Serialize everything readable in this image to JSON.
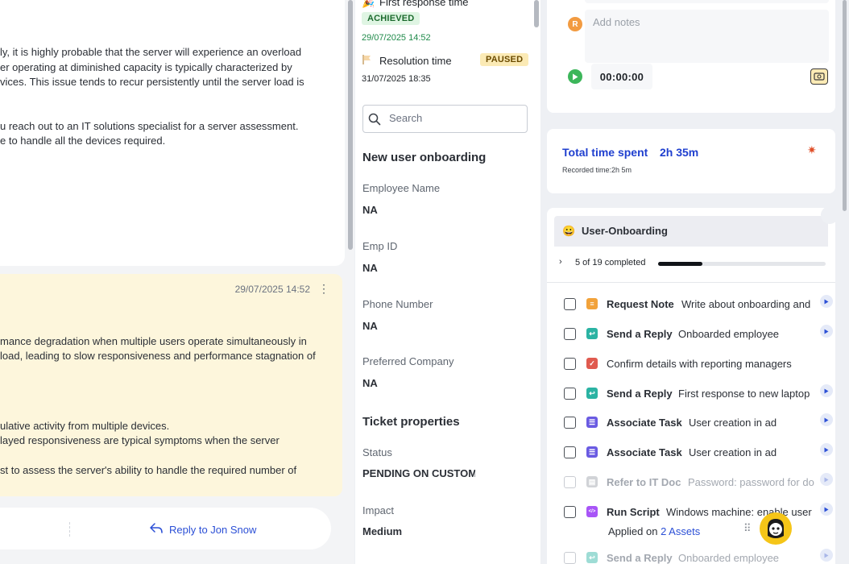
{
  "conversation": {
    "message1_lines": [
      "ly, it is highly probable that the server will experience an overload",
      "er operating at diminished capacity is typically characterized by",
      "vices. This issue tends to recur persistently until the server load is",
      "u reach out to an IT solutions specialist for a server assessment.",
      "e to handle all the devices required."
    ],
    "message2_timestamp": "29/07/2025 14:52",
    "message2_lines": [
      "mance degradation when multiple users operate simultaneously in",
      "load, leading to slow responsiveness and performance stagnation of",
      "ulative activity from multiple devices.",
      "layed responsiveness are typical symptoms when the server",
      "st to assess the server's ability to handle the required number of"
    ],
    "more_label": "⋮",
    "reply_label": "Reply to Jon Snow"
  },
  "sla": {
    "first_response_label": "First response time",
    "first_response_status": "ACHIEVED",
    "first_response_date": "29/07/2025 14:52",
    "resolution_label": "Resolution time",
    "resolution_status": "PAUSED",
    "resolution_date": "31/07/2025 18:35"
  },
  "search": {
    "placeholder": "Search"
  },
  "onboarding": {
    "title": "New user onboarding",
    "fields": [
      {
        "label": "Employee Name",
        "value": "NA"
      },
      {
        "label": "Emp ID",
        "value": "NA"
      },
      {
        "label": "Phone Number",
        "value": "NA"
      },
      {
        "label": "Preferred Company",
        "value": "NA"
      }
    ]
  },
  "ticket_properties": {
    "title": "Ticket properties",
    "status_label": "Status",
    "status_value": "PENDING ON CUSTOM",
    "impact_label": "Impact",
    "impact_value": "Medium"
  },
  "notes": {
    "avatar_initial": "R",
    "placeholder": "Add notes",
    "timer": "00:00:00"
  },
  "time_tracking": {
    "total_label": "Total time spent",
    "total_value": "2h 35m",
    "recorded": "Recorded time:2h 5m"
  },
  "tasks": {
    "group_title": "User-Onboarding",
    "progress_text": "5 of 19 completed",
    "progress_completed": 5,
    "progress_total": 19,
    "items": [
      {
        "title": "Request Note",
        "desc": "Write about onboarding and",
        "icon": "note-icon",
        "color": "#f2a23a"
      },
      {
        "title": "Send a Reply",
        "desc": "Onboarded employee",
        "icon": "reply-icon",
        "color": "#2bb3a3"
      },
      {
        "title": "",
        "desc": "Confirm details with reporting managers",
        "icon": "checklist-icon",
        "color": "#e05a4f"
      },
      {
        "title": "Send a Reply",
        "desc": "First response to new laptop",
        "icon": "reply-icon",
        "color": "#2bb3a3"
      },
      {
        "title": "Associate Task",
        "desc": "User creation in ad",
        "icon": "task-icon",
        "color": "#6a5be2"
      },
      {
        "title": "Associate Task",
        "desc": "User creation in ad",
        "icon": "task-icon",
        "color": "#6a5be2"
      },
      {
        "title": "Refer to IT Doc",
        "desc": "Password: password for do",
        "icon": "document-icon",
        "color": "#9aa0a8"
      },
      {
        "title": "Run Script",
        "desc": "Windows machine: enable user",
        "icon": "script-icon",
        "color": "#a855f7"
      },
      {
        "title": "Send a Reply",
        "desc": "Onboarded employee",
        "icon": "reply-icon",
        "color": "#2bb3a3"
      }
    ],
    "applied_prefix": "Applied on ",
    "applied_link": "2 Assets"
  },
  "colors": {
    "accent_blue": "#1f3fcf",
    "achieved_bg": "#dff5e3",
    "paused_bg": "#fbeab5",
    "message_highlight": "#fdf6dc"
  }
}
